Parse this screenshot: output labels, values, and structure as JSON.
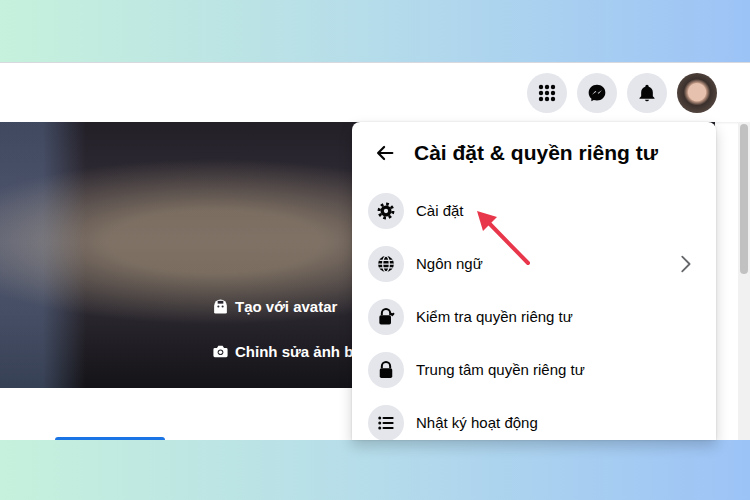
{
  "cover": {
    "buttons": [
      {
        "label": "Tạo với avatar"
      },
      {
        "label": "Chỉnh sửa ảnh bì"
      }
    ]
  },
  "menu": {
    "title": "Cài đặt & quyền riêng tư",
    "items": [
      {
        "label": "Cài đặt",
        "submenu": false,
        "pointed": true
      },
      {
        "label": "Ngôn ngữ",
        "submenu": true,
        "pointed": false
      },
      {
        "label": "Kiểm tra quyền riêng tư",
        "submenu": false,
        "pointed": false
      },
      {
        "label": "Trung tâm quyền riêng tư",
        "submenu": false,
        "pointed": false
      },
      {
        "label": "Nhật ký hoạt động",
        "submenu": false,
        "pointed": false
      }
    ]
  }
}
